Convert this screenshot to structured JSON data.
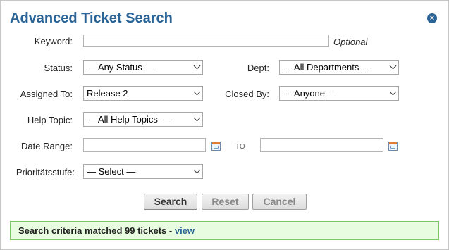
{
  "dialog": {
    "title": "Advanced Ticket Search",
    "close_icon": "close-circle-icon"
  },
  "form": {
    "keyword": {
      "label": "Keyword:",
      "value": "",
      "hint": "Optional"
    },
    "status": {
      "label": "Status:",
      "selected": "— Any Status —"
    },
    "dept": {
      "label": "Dept:",
      "selected": "— All Departments —"
    },
    "assigned_to": {
      "label": "Assigned To:",
      "selected": "Release 2"
    },
    "closed_by": {
      "label": "Closed By:",
      "selected": "— Anyone —"
    },
    "help_topic": {
      "label": "Help Topic:",
      "selected": "— All Help Topics —"
    },
    "date_range": {
      "label": "Date Range:",
      "from": "",
      "to_label": "TO",
      "to": "",
      "calendar_icon": "calendar-icon"
    },
    "priority": {
      "label": "Prioritätsstufe:",
      "selected": "— Select —"
    }
  },
  "buttons": {
    "search": "Search",
    "reset": "Reset",
    "cancel": "Cancel"
  },
  "result": {
    "message": "Search criteria matched 99 tickets",
    "separator": " - ",
    "link": "view"
  },
  "colors": {
    "title": "#2a6496",
    "result_bg": "#e8fce0",
    "result_border": "#7fc66a"
  }
}
